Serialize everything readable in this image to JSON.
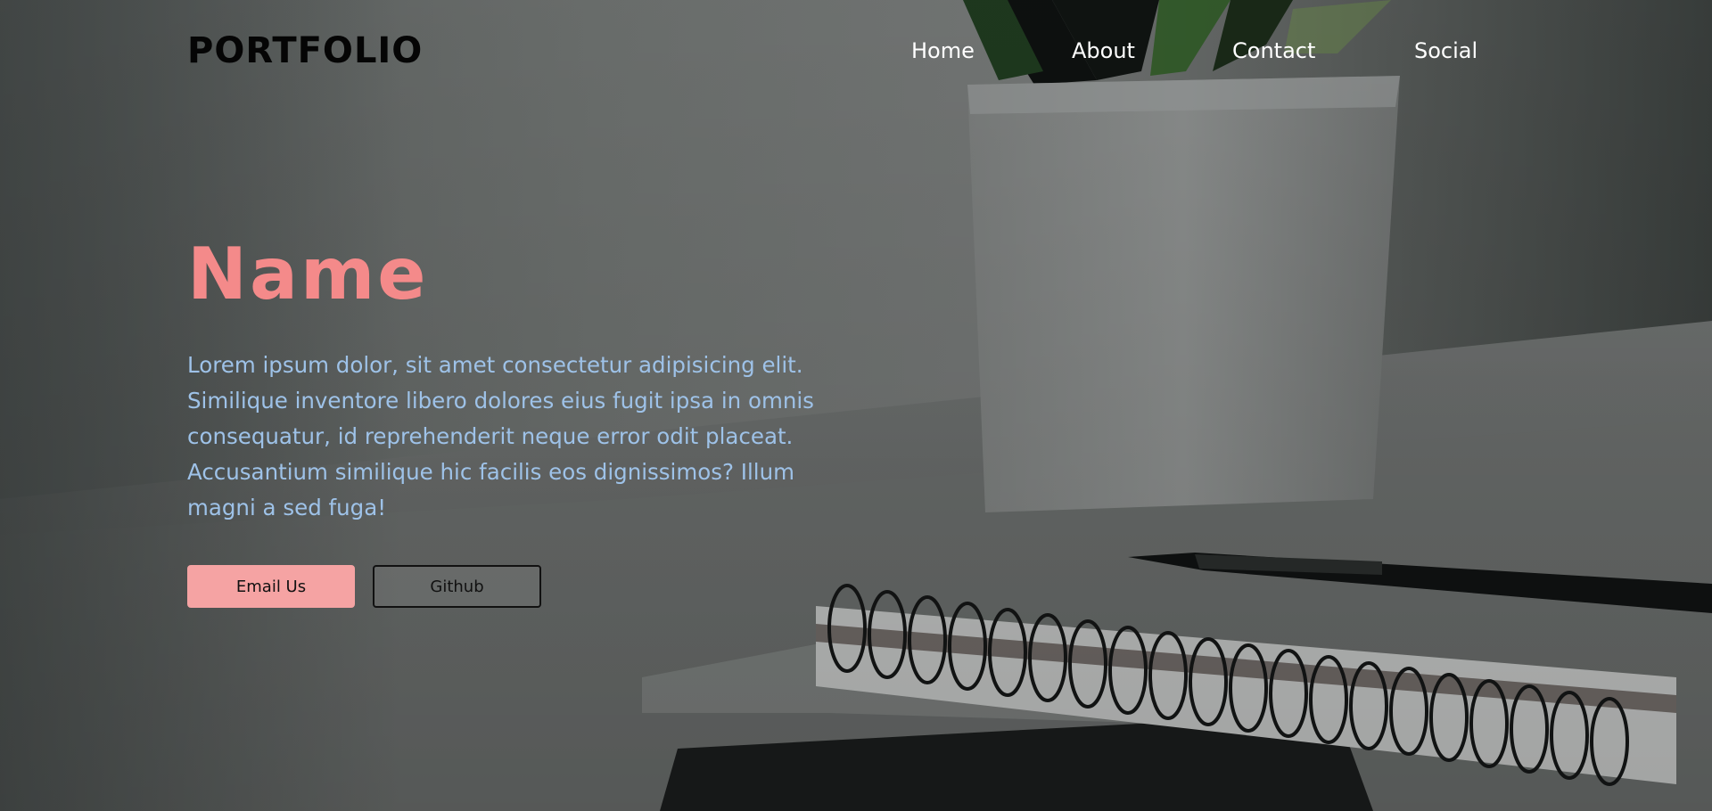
{
  "nav": {
    "brand": "PORTFOLIO",
    "links": [
      {
        "label": "Home"
      },
      {
        "label": "About"
      },
      {
        "label": "Contact"
      },
      {
        "label": "Social"
      }
    ]
  },
  "hero": {
    "name": "Name",
    "description": "Lorem ipsum dolor, sit amet consectetur adipisicing elit. Similique inventore libero dolores eius fugit ipsa in omnis consequatur, id reprehenderit neque error odit placeat. Accusantium similique hic facilis eos dignissimos? Illum magni a sed fuga!",
    "buttons": {
      "email_label": "Email Us",
      "github_label": "Github"
    }
  },
  "colors": {
    "brand_text": "#050505",
    "name_accent": "#f48a8a",
    "body_text": "#9ec2e8",
    "primary_button": "#f5a3a3",
    "nav_link": "#ffffff"
  }
}
